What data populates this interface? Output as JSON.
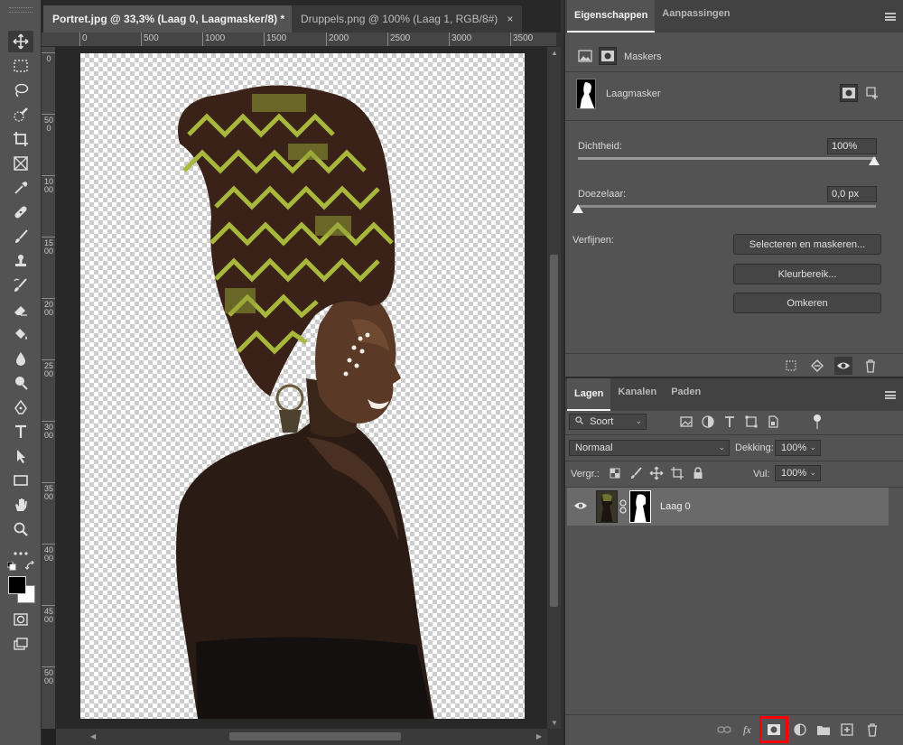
{
  "document_tabs": [
    {
      "label": "Portret.jpg @ 33,3% (Laag 0, Laagmasker/8) *",
      "close": "×"
    },
    {
      "label": "Druppels.png @ 100% (Laag 1, RGB/8#)",
      "close": "×"
    }
  ],
  "ruler_top": [
    "0",
    "500",
    "1000",
    "1500",
    "2000",
    "2500",
    "3000",
    "3500"
  ],
  "ruler_left": [
    "0",
    "500",
    "1000",
    "1500",
    "2000",
    "2500",
    "3000",
    "3500",
    "4000",
    "4500",
    "5000"
  ],
  "tools": [
    "move-tool",
    "marquee-tool",
    "lasso-tool",
    "quick-selection-tool",
    "crop-tool",
    "frame-tool",
    "eyedropper-tool",
    "healing-brush-tool",
    "brush-tool",
    "clone-stamp-tool",
    "history-brush-tool",
    "eraser-tool",
    "paint-bucket-tool",
    "blur-tool",
    "dodge-tool",
    "pen-tool",
    "type-tool",
    "path-selection-tool",
    "rectangle-tool",
    "hand-tool",
    "zoom-tool",
    "more-tools",
    "quick-mask",
    "screen-mode"
  ],
  "properties": {
    "tabs": [
      "Eigenschappen",
      "Aanpassingen"
    ],
    "section_title": "Maskers",
    "mask_name": "Laagmasker",
    "density_label": "Dichtheid:",
    "density_value": "100%",
    "feather_label": "Doezelaar:",
    "feather_value": "0,0 px",
    "refine_label": "Verfijnen:",
    "buttons": [
      "Selecteren en maskeren...",
      "Kleurbereik...",
      "Omkeren"
    ]
  },
  "layers": {
    "tabs": [
      "Lagen",
      "Kanalen",
      "Paden"
    ],
    "filter_kind": "Soort",
    "blend_mode": "Normaal",
    "opacity_label": "Dekking:",
    "opacity_value": "100%",
    "lock_label": "Vergr.:",
    "fill_label": "Vul:",
    "fill_value": "100%",
    "layer_name": "Laag 0"
  },
  "colors": {
    "highlight": "#ff0000",
    "panel_bg": "#535353",
    "selected_layer": "#6a6a6a"
  }
}
